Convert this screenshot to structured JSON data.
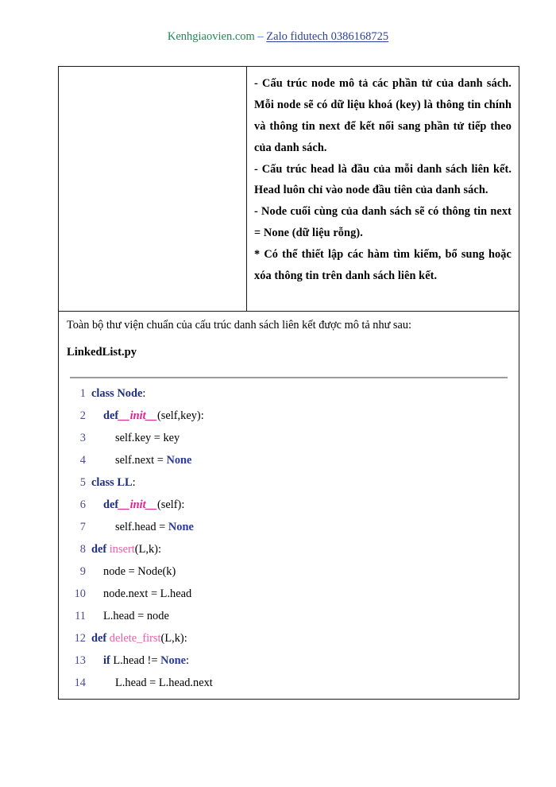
{
  "header": {
    "site": "Kenhgiaovien.com",
    "separator": " – ",
    "zalo": "Zalo fidutech 0386168725",
    "site_color": "#1F8A54",
    "zalo_color": "#2D3FA0"
  },
  "table": {
    "left_cell": {
      "content": ""
    },
    "right_cell": {
      "paragraphs": [
        "- Cấu trúc node mô tả các phần tử của danh sách. Mỗi node sẽ có dữ liệu khoá (key) là thông tin chính và thông tin next để kết nối sang phần tử tiếp theo của danh sách.",
        "- Cấu trúc head là đầu của mỗi danh sách liên kết. Head luôn chỉ vào node đầu tiên của danh sách.",
        "- Node cuối cùng của danh sách sẽ có thông tin next = None (dữ liệu rỗng).",
        "* Có thể thiết lập các hàm tìm kiếm, bổ sung hoặc xóa thông tin trên danh sách liên kết."
      ]
    }
  },
  "body": {
    "intro": "Toàn bộ thư viện chuẩn của cấu trúc danh sách liên kết được mô tả như sau:",
    "file_heading": "LinkedList.py"
  },
  "code": {
    "language": "python",
    "colors": {
      "line_number": "#4B4C8F",
      "keyword": "#1F2E7A",
      "dunder": "#D6268F",
      "function": "#EE5CA8",
      "none_literal": "#2A3A9E",
      "plain": "#000000",
      "rule": "#9b9b9b"
    },
    "lines": [
      {
        "n": "1",
        "indent": 0,
        "tokens": [
          {
            "t": "class",
            "c": "kw"
          },
          {
            "t": " ",
            "c": "plain"
          },
          {
            "t": "Node",
            "c": "kw"
          },
          {
            "t": ":",
            "c": "plain"
          }
        ]
      },
      {
        "n": "2",
        "indent": 1,
        "tokens": [
          {
            "t": "def",
            "c": "kw"
          },
          {
            "t": "__init__",
            "c": "dunder"
          },
          {
            "t": "(self,key):",
            "c": "plain"
          }
        ]
      },
      {
        "n": "3",
        "indent": 2,
        "tokens": [
          {
            "t": "self.key = key",
            "c": "plain"
          }
        ]
      },
      {
        "n": "4",
        "indent": 2,
        "tokens": [
          {
            "t": "self.next = ",
            "c": "plain"
          },
          {
            "t": "None",
            "c": "none"
          }
        ]
      },
      {
        "n": "5",
        "indent": 0,
        "tokens": [
          {
            "t": "class",
            "c": "kw"
          },
          {
            "t": " ",
            "c": "plain"
          },
          {
            "t": "LL",
            "c": "kw"
          },
          {
            "t": ":",
            "c": "plain"
          }
        ]
      },
      {
        "n": "6",
        "indent": 1,
        "tokens": [
          {
            "t": "def",
            "c": "kw"
          },
          {
            "t": "__init__",
            "c": "dunder"
          },
          {
            "t": "(self):",
            "c": "plain"
          }
        ]
      },
      {
        "n": "7",
        "indent": 2,
        "tokens": [
          {
            "t": "self.head = ",
            "c": "plain"
          },
          {
            "t": "None",
            "c": "none"
          }
        ]
      },
      {
        "n": "8",
        "indent": 0,
        "tokens": [
          {
            "t": "def",
            "c": "kw"
          },
          {
            "t": " ",
            "c": "plain"
          },
          {
            "t": "insert",
            "c": "fn"
          },
          {
            "t": "(L,k):",
            "c": "plain"
          }
        ]
      },
      {
        "n": "9",
        "indent": 1,
        "tokens": [
          {
            "t": "node = Node(k)",
            "c": "plain"
          }
        ]
      },
      {
        "n": "10",
        "indent": 1,
        "tokens": [
          {
            "t": "node.next = L.head",
            "c": "plain"
          }
        ]
      },
      {
        "n": "11",
        "indent": 1,
        "tokens": [
          {
            "t": "L.head = node",
            "c": "plain"
          }
        ]
      },
      {
        "n": "12",
        "indent": 0,
        "tokens": [
          {
            "t": "def",
            "c": "kw"
          },
          {
            "t": " ",
            "c": "plain"
          },
          {
            "t": "delete_first",
            "c": "fn"
          },
          {
            "t": "(L,k):",
            "c": "plain"
          }
        ]
      },
      {
        "n": "13",
        "indent": 1,
        "tokens": [
          {
            "t": "if",
            "c": "kw"
          },
          {
            "t": " L.head != ",
            "c": "plain"
          },
          {
            "t": "None",
            "c": "none"
          },
          {
            "t": ":",
            "c": "plain"
          }
        ]
      },
      {
        "n": "14",
        "indent": 2,
        "tokens": [
          {
            "t": "L.head = L.head.next",
            "c": "plain"
          }
        ]
      }
    ]
  }
}
